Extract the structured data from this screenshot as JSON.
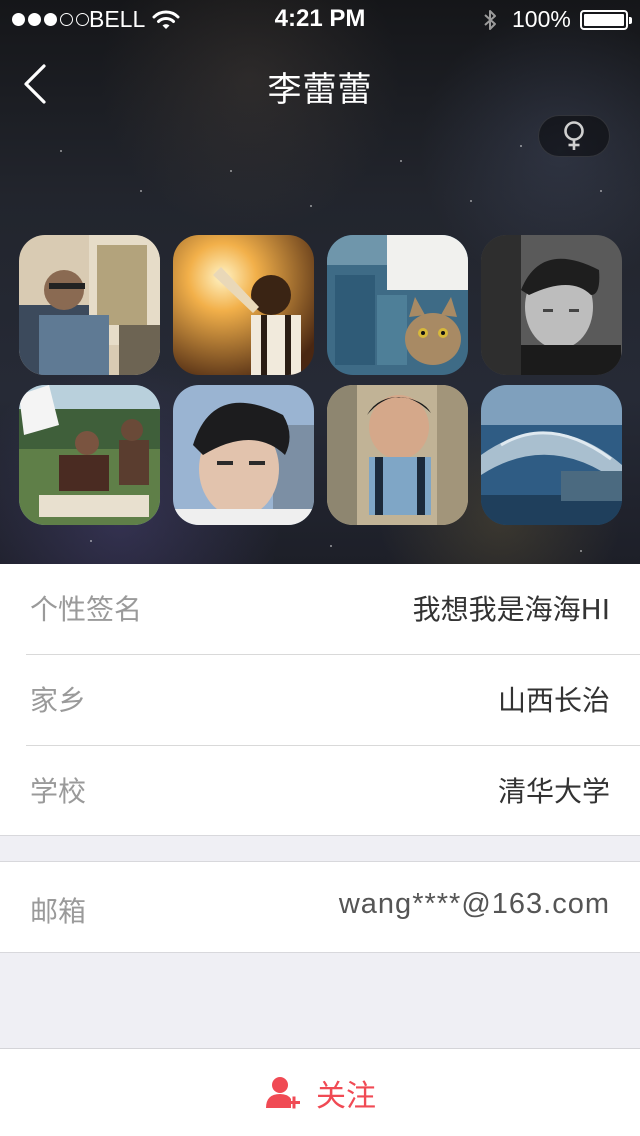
{
  "status_bar": {
    "carrier": "BELL",
    "time": "4:21 PM",
    "battery": "100%",
    "signal_bars_filled": 3,
    "signal_bars_total": 5
  },
  "nav": {
    "title": "李蕾蕾",
    "back_icon": "chevron-left-icon",
    "gender_icon": "female-icon"
  },
  "photos": [
    {
      "icon": "photo-man-with-painting"
    },
    {
      "icon": "photo-man-sunset"
    },
    {
      "icon": "photo-cat-window"
    },
    {
      "icon": "photo-man-bw-portrait"
    },
    {
      "icon": "photo-picnic-couple"
    },
    {
      "icon": "photo-man-closeup"
    },
    {
      "icon": "photo-man-looking-up"
    },
    {
      "icon": "photo-stone-bridge"
    }
  ],
  "profile": {
    "signature_label": "个性签名",
    "signature_value": "我想我是海海HI",
    "hometown_label": "家乡",
    "hometown_value": "山西长治",
    "school_label": "学校",
    "school_value": "清华大学",
    "email_label": "邮箱",
    "email_value": "wang****@163.com"
  },
  "follow": {
    "label": "关注",
    "icon": "add-user-icon",
    "color": "#f04a54"
  }
}
